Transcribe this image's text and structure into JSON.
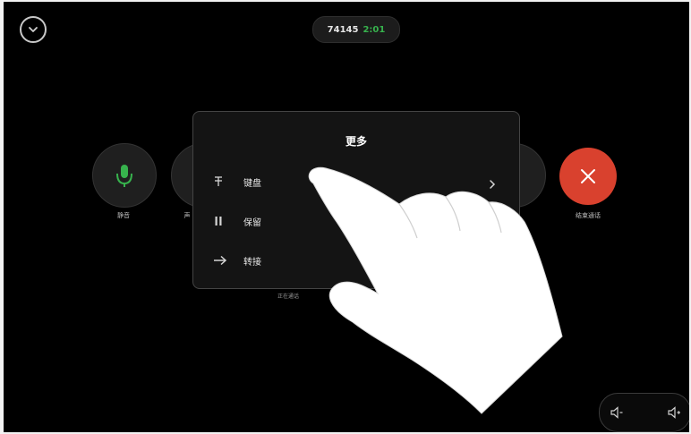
{
  "call": {
    "id": "74145",
    "duration": "2:01"
  },
  "toolbar": {
    "left_button_label": "静音",
    "second_button_label": "声",
    "end_call_label": "结束通话",
    "hint_label": "正在通话"
  },
  "modal": {
    "title": "更多",
    "items": [
      {
        "icon": "keypad-icon",
        "label": "键盘",
        "has_chevron": true
      },
      {
        "icon": "hold-icon",
        "label": "保留",
        "has_chevron": false
      },
      {
        "icon": "transfer-icon",
        "label": "转接",
        "has_chevron": false
      }
    ]
  },
  "icons": {
    "collapse": "chevron-down-icon",
    "mute": "microphone-icon",
    "end_call": "close-icon",
    "volume_down": "volume-down-icon",
    "volume_up": "volume-up-icon",
    "gesture": "pointing-hand-icon"
  },
  "colors": {
    "background": "#000000",
    "accent_green": "#37b24d",
    "end_call_red": "#d9412e",
    "modal_background": "#141414"
  }
}
